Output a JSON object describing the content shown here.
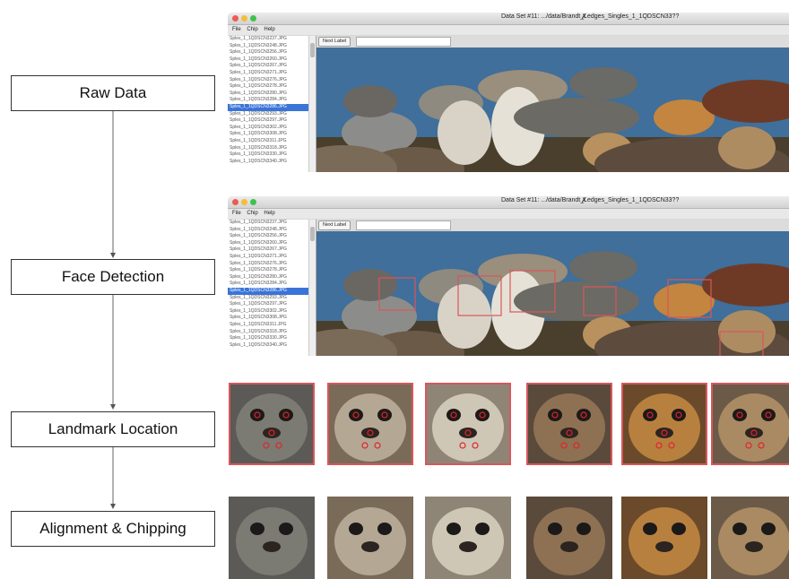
{
  "pipeline": {
    "stages": [
      {
        "label": "Raw Data"
      },
      {
        "label": "Face Detection"
      },
      {
        "label": "Landmark Location"
      },
      {
        "label": "Alignment & Chipping"
      }
    ]
  },
  "app_window": {
    "title": "Data Set #11: .../data/Brandt_Ledges_Singles_1_1QDSCN33??",
    "menu": [
      "File",
      "Chip",
      "Help"
    ],
    "next_label_button": "Next Label",
    "label_input_value": "",
    "file_list": [
      "Sples_1_1QDSCN3237.JPG",
      "Sples_1_1QDSCN3248.JPG",
      "Sples_1_1QDSCN3256.JPG",
      "Sples_1_1QDSCN3260.JPG",
      "Sples_1_1QDSCN3267.JPG",
      "Sples_1_1QDSCN3271.JPG",
      "Sples_1_1QDSCN3276.JPG",
      "Sples_1_1QDSCN3278.JPG",
      "Sples_1_1QDSCN3280.JPG",
      "Sples_1_1QDSCN3284.JPG",
      "Sples_1_1QDSCN3286.JPG",
      "Sples_1_1QDSCN3293.JPG",
      "Sples_1_1QDSCN3297.JPG",
      "Sples_1_1QDSCN3302.JPG",
      "Sples_1_1QDSCN3308.JPG",
      "Sples_1_1QDSCN3311.JPG",
      "Sples_1_1QDSCN3318.JPG",
      "Sples_1_1QDSCN3330.JPG",
      "Sples_1_1QDSCN3340.JPG"
    ],
    "selected_index": 10
  },
  "colors": {
    "detection_box": "#d9565c",
    "landmark": "#e0242b",
    "selection": "#3a74d8",
    "water": "#3f6f9a",
    "seal_tan": "#b58a5c",
    "seal_dark": "#5a4a3c"
  }
}
